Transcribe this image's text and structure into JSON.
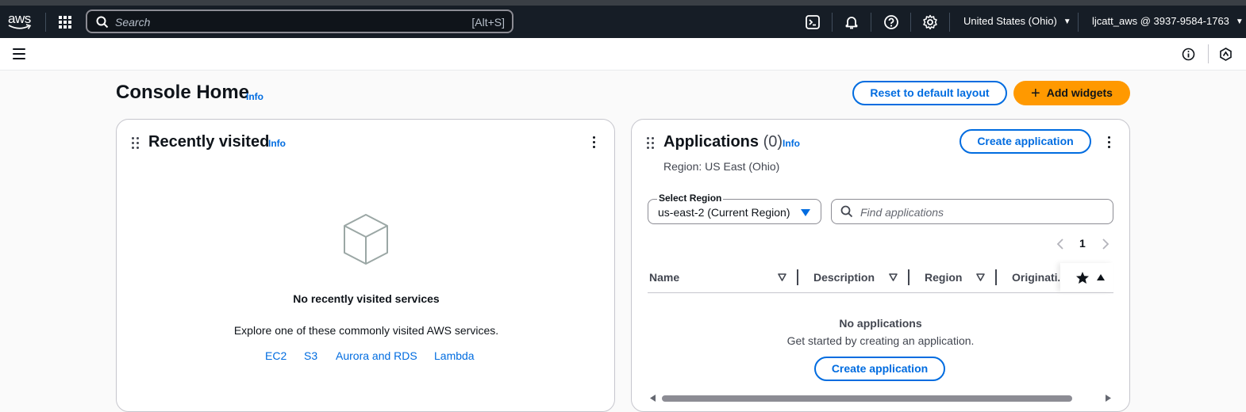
{
  "topnav": {
    "logo_text": "aws",
    "search_placeholder": "Search",
    "search_shortcut": "[Alt+S]",
    "region": "United States (Ohio)",
    "account": "ljcatt_aws @ 3937-9584-1763",
    "icons": [
      "services-grid-icon",
      "search-icon",
      "cloudshell-icon",
      "notifications-bell-icon",
      "help-icon",
      "settings-gear-icon"
    ]
  },
  "subbar": {
    "icons": [
      "menu-icon",
      "info-panel-icon",
      "tools-panel-icon"
    ]
  },
  "page": {
    "title": "Console Home",
    "info": "Info",
    "reset_button": "Reset to default layout",
    "add_widgets_button": "Add widgets"
  },
  "recently_visited": {
    "title": "Recently visited",
    "info": "Info",
    "empty_title": "No recently visited services",
    "empty_text": "Explore one of these commonly visited AWS services.",
    "links": [
      "EC2",
      "S3",
      "Aurora and RDS",
      "Lambda"
    ]
  },
  "applications": {
    "title": "Applications",
    "count": "(0)",
    "info": "Info",
    "create_button": "Create application",
    "region_text": "Region: US East (Ohio)",
    "select_label": "Select Region",
    "select_value": "us-east-2 (Current Region)",
    "find_placeholder": "Find applications",
    "page_number": "1",
    "columns": [
      "Name",
      "Description",
      "Region",
      "Originati..."
    ],
    "empty_title": "No applications",
    "empty_text": "Get started by creating an application.",
    "empty_create_button": "Create application"
  },
  "colors": {
    "nav_bg": "#161d26",
    "link_blue": "#006ce0",
    "primary_orange": "#ff9900"
  }
}
